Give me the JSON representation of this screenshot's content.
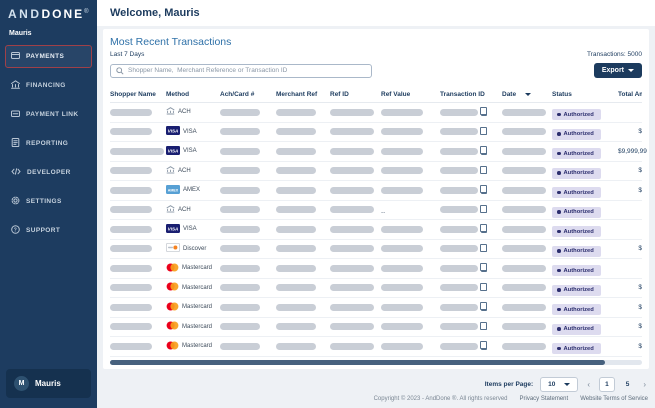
{
  "colors": {
    "sidebar_navy": "#1d3c60",
    "active_border_red": "#a04048",
    "title_blue": "#2f71a8",
    "text_navy": "#1c3b5e",
    "status_pill_bg": "#dddbef",
    "status_text": "#2c2e6e",
    "visa_blue": "#1a1f71",
    "amex_blue": "#57a0d4",
    "mastercard_red": "#eb001b",
    "mastercard_orange": "#f79e1b"
  },
  "sidebar": {
    "logo": {
      "and": "AND",
      "done": "DONE",
      "reg": "®"
    },
    "user_label": "Mauris",
    "items": [
      {
        "label": "PAYMENTS",
        "icon": "payments-icon",
        "active": true
      },
      {
        "label": "FINANCING",
        "icon": "financing-icon",
        "active": false
      },
      {
        "label": "PAYMENT LINK",
        "icon": "payment-link-icon",
        "active": false
      },
      {
        "label": "REPORTING",
        "icon": "reporting-icon",
        "active": false
      },
      {
        "label": "DEVELOPER",
        "icon": "developer-icon",
        "active": false
      },
      {
        "label": "SETTINGS",
        "icon": "settings-icon",
        "active": false
      },
      {
        "label": "SUPPORT",
        "icon": "support-icon",
        "active": false
      }
    ],
    "profile": {
      "initial": "M",
      "name": "Mauris"
    }
  },
  "header": {
    "welcome": "Welcome, Mauris"
  },
  "panel": {
    "title": "Most Recent Transactions",
    "subtitle": "Last 7 Days",
    "transactions_label": "Transactions: 5000",
    "export_label": "Export",
    "search_placeholder": "Shopper Name,  Merchant Reference or Transaction ID"
  },
  "table": {
    "columns": [
      {
        "label": "Shopper Name",
        "sort": false
      },
      {
        "label": "Method",
        "sort": false
      },
      {
        "label": "Ach/Card #",
        "sort": false
      },
      {
        "label": "Merchant Ref",
        "sort": false
      },
      {
        "label": "Ref ID",
        "sort": false
      },
      {
        "label": "Ref Value",
        "sort": false
      },
      {
        "label": "Transaction ID",
        "sort": false
      },
      {
        "label": "Date",
        "sort": true
      },
      {
        "label": "Status",
        "sort": false
      },
      {
        "label": "Total Am",
        "sort": false
      }
    ],
    "rows": [
      {
        "method": "ACH",
        "icon": "ach-icon",
        "ref_value": "bar",
        "status": "Authorized",
        "amount": ""
      },
      {
        "method": "VISA",
        "icon": "visa-icon",
        "ref_value": "bar",
        "status": "Authorized",
        "amount": "$"
      },
      {
        "method": "VISA",
        "icon": "visa-icon",
        "ref_value": "bar",
        "status": "Authorized",
        "amount": "$9,999,99",
        "shopper_wide": true
      },
      {
        "method": "ACH",
        "icon": "ach-icon",
        "ref_value": "bar",
        "status": "Authorized",
        "amount": "$"
      },
      {
        "method": "AMEX",
        "icon": "amex-icon",
        "ref_value": "bar",
        "status": "Authorized",
        "amount": "$"
      },
      {
        "method": "ACH",
        "icon": "ach-icon",
        "ref_value": "--",
        "status": "Authorized",
        "amount": ""
      },
      {
        "method": "VISA",
        "icon": "visa-icon",
        "ref_value": "bar",
        "status": "Authorized",
        "amount": ""
      },
      {
        "method": "Discover",
        "icon": "discover-icon",
        "ref_value": "bar",
        "status": "Authorized",
        "amount": "$"
      },
      {
        "method": "Mastercard",
        "icon": "mastercard-icon",
        "ref_value": "bar",
        "status": "Authorized",
        "amount": ""
      },
      {
        "method": "Mastercard",
        "icon": "mastercard-icon",
        "ref_value": "bar",
        "status": "Authorized",
        "amount": "$"
      },
      {
        "method": "Mastercard",
        "icon": "mastercard-icon",
        "ref_value": "bar",
        "status": "Authorized",
        "amount": "$"
      },
      {
        "method": "Mastercard",
        "icon": "mastercard-icon",
        "ref_value": "bar",
        "status": "Authorized",
        "amount": "$"
      },
      {
        "method": "Mastercard",
        "icon": "mastercard-icon",
        "ref_value": "bar",
        "status": "Authorized",
        "amount": "$"
      }
    ]
  },
  "pagination": {
    "items_per_page_label": "Items per Page:",
    "items_per_page_value": "10",
    "prev": "‹",
    "next": "›",
    "pages": [
      {
        "label": "1",
        "active": true
      },
      {
        "label": "5",
        "active": false
      }
    ]
  },
  "footer": {
    "copyright": "Copyright © 2023 - AndDone ®. All rights reserved",
    "privacy": "Privacy Statement",
    "terms": "Website Terms of Service"
  }
}
